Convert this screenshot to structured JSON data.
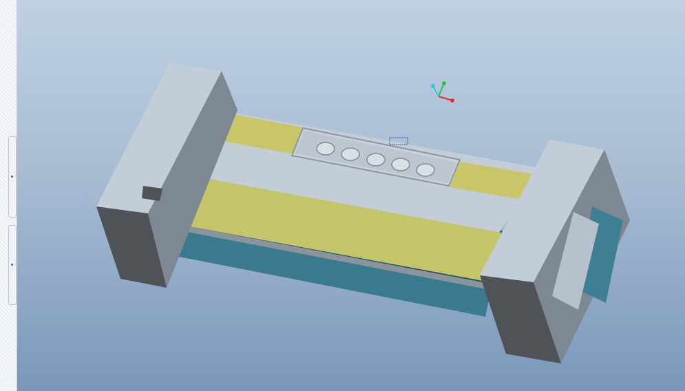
{
  "window": {
    "title": ""
  },
  "viewport": {
    "background_top": "#bfd0e3",
    "background_bottom": "#7a97bb"
  },
  "model": {
    "frame_color": "#c3cdd7",
    "frame_shadow_color": "#4f5257",
    "pad_color": "#c9c66a",
    "roller_color": "#3e7f93",
    "control_panel_buttons": 5
  },
  "triad": {
    "x_color": "#e03030",
    "y_color": "#2fbf3a",
    "z_color": "#36c7d8"
  },
  "icons": [
    "coordinate-triad-icon",
    "sash-grip-icon"
  ]
}
